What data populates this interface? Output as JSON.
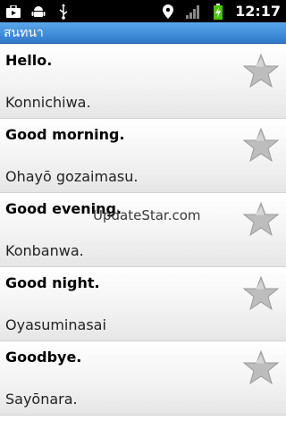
{
  "status_bar": {
    "time": "12:17",
    "left_icons": [
      "briefcase-icon",
      "android-icon",
      "usb-icon"
    ],
    "right_icons": [
      "location-icon",
      "signal-icon",
      "battery-charging-icon"
    ]
  },
  "title_bar": {
    "title": "สนทนา"
  },
  "phrases": [
    {
      "english": "Hello.",
      "japanese": "Konnichiwa.",
      "starred": false
    },
    {
      "english": "Good morning.",
      "japanese": "Ohayō gozaimasu.",
      "starred": false
    },
    {
      "english": "Good evening.",
      "japanese": "Konbanwa.",
      "starred": false
    },
    {
      "english": "Good night.",
      "japanese": "Oyasuminasai",
      "starred": false
    },
    {
      "english": "Goodbye.",
      "japanese": "Sayōnara.",
      "starred": false
    }
  ],
  "watermark": "UpdateStar.com",
  "colors": {
    "title_bar": "#3b8ad8",
    "star": "#bdbdbd"
  }
}
